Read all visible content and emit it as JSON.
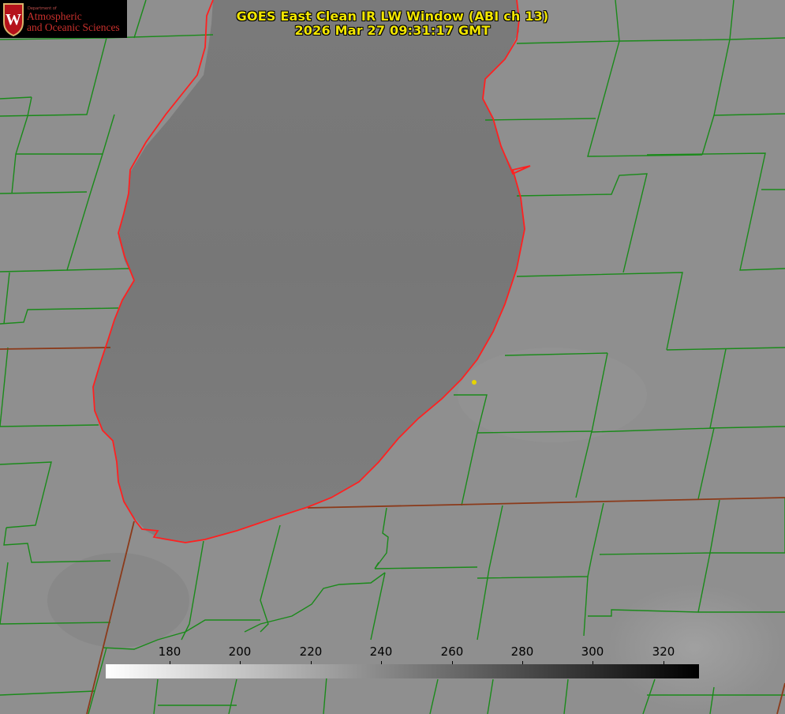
{
  "title": {
    "line1": "GOES East Clean IR LW Window (ABI ch 13)",
    "line2": "2026 Mar 27 09:31:17 GMT"
  },
  "logo": {
    "dept": "Department of",
    "line1": "Atmospheric",
    "line2": "and Oceanic Sciences",
    "crest_letter": "W"
  },
  "colorbar": {
    "ticks": [
      "180",
      "200",
      "220",
      "240",
      "260",
      "280",
      "300",
      "320"
    ],
    "min_color": "#ffffff",
    "max_color": "#000000"
  },
  "colors": {
    "county_lines": "#1a8a1a",
    "state_lines": "#8b3a1a",
    "coastline": "#ff2020",
    "title_text": "#f2e600",
    "station_marker": "#e6d400"
  }
}
